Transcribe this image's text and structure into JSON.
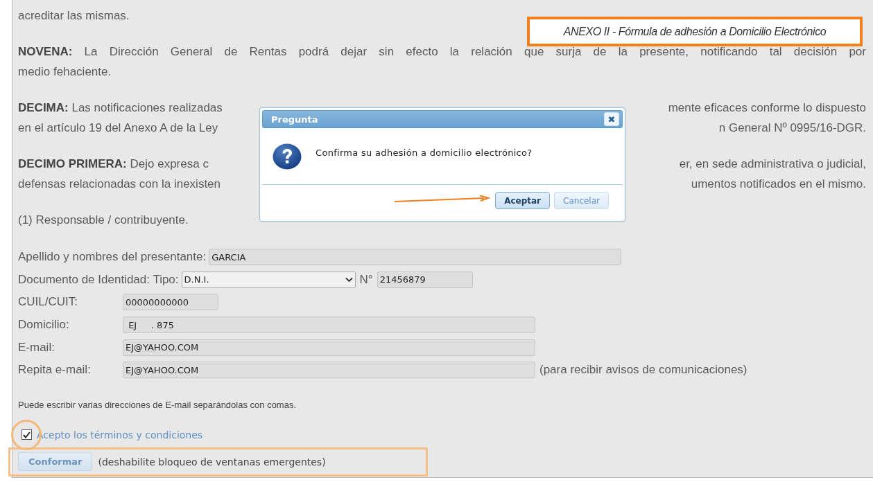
{
  "header_note": "ANEXO II - Fórmula de adhesión a Domicilio Electrónico",
  "document": {
    "paragraphs": [
      {
        "lines": [
          {
            "text": "acreditar las mismas."
          }
        ]
      },
      {
        "lines": [
          {
            "text": "**NOVENA:** La Dirección General de Rentas podrá dejar sin efecto la relación que surja de la presente, notificando tal decisión por"
          },
          {
            "text": "medio fehaciente."
          }
        ]
      },
      {
        "lines": [
          {
            "left": "**DECIMA:** Las notificaciones realizadas",
            "right": "mente eficaces conforme lo dispuesto"
          },
          {
            "left": "en el artículo 19 del Anexo A de la Ley",
            "right": "n General Nº 0995/16-DGR."
          }
        ]
      },
      {
        "lines": [
          {
            "left": "**DECIMO PRIMERA:** Dejo expresa c",
            "right": "er, en sede administrativa o judicial,"
          },
          {
            "left": "defensas relacionadas con la inexisten",
            "right": "umentos notificados en el mismo."
          }
        ]
      },
      {
        "lines": [
          {
            "text": "(1) Responsable / contribuyente."
          }
        ]
      }
    ]
  },
  "form": {
    "fields": [
      {
        "kind": "inline-text",
        "label": "Apellido y nombres del presentante:",
        "value": "GARCIA"
      },
      {
        "kind": "document",
        "label": "Documento de Identidad: Tipo:",
        "value": "D.N.I.",
        "number_label": "N°",
        "number": "21456879"
      },
      {
        "kind": "short-text",
        "label": "CUIL/CUIT:",
        "value": "00000000000"
      },
      {
        "kind": "text",
        "label": "Domicilio:",
        "value": " EJ     . 875"
      },
      {
        "kind": "text",
        "label": "E-mail:",
        "value": "EJ@YAHOO.COM"
      },
      {
        "kind": "text",
        "label": "Repita e-mail:",
        "value": "EJ@YAHOO.COM",
        "note": "(para recibir avisos de comunicaciones)"
      }
    ],
    "hint": "Puede escribir varias direcciones de E-mail separándolas con comas.",
    "terms": {
      "label": "Acepto los términos y condiciones",
      "checked": true
    },
    "submit": {
      "label": "Conformar",
      "note": "(deshabilite bloqueo de ventanas emergentes)"
    }
  },
  "dialog": {
    "title": "Pregunta",
    "close": "✖",
    "message": "Confirma su adhesión a domicilio electrónico?",
    "buttons": [
      {
        "label": "Aceptar",
        "focused": true
      },
      {
        "label": "Cancelar",
        "focused": false
      }
    ]
  }
}
